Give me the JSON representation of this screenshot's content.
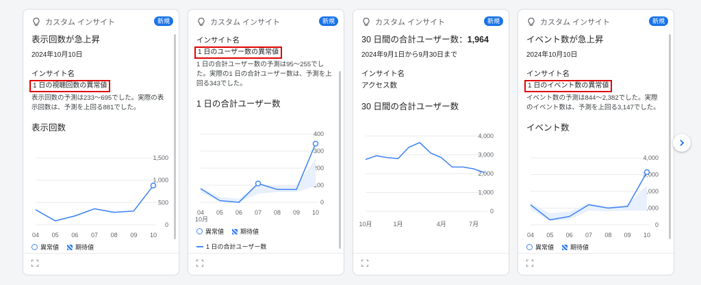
{
  "cards": [
    {
      "header": "カスタム インサイト",
      "badge": "新規",
      "title": "表示回数が急上昇",
      "date": "2024年10月10日",
      "insight_label": "インサイト名",
      "insight_name": "1 日の視聴回数の異常値",
      "description": "表示回数の予測は233～695でした。実際の表示回数は、予測を上回る881でした。",
      "chart_title": "表示回数",
      "legend_anomaly": "異常値",
      "legend_expected": "期待値"
    },
    {
      "header": "カスタム インサイト",
      "badge": "新規",
      "insight_label": "インサイト名",
      "insight_name": "1 日のユーザー数の異常値",
      "description": "1 日の合計ユーザー数の予測は95～255でした。実際の1 日の合計ユーザー数は、予測を上回る343でした。",
      "chart_title": "1 日の合計ユーザー数",
      "legend_anomaly": "異常値",
      "legend_expected": "期待値",
      "legend_series": "1 日の合計ユーザー数"
    },
    {
      "header": "カスタム インサイト",
      "badge": "新規",
      "title_prefix": "30 日間の合計ユーザー数：",
      "title_value": "1,964",
      "date": "2024年9月1日から9月30日まで",
      "insight_label": "インサイト名",
      "insight_name": "アクセス数",
      "chart_title": "30 日間の合計ユーザー数"
    },
    {
      "header": "カスタム インサイト",
      "badge": "新規",
      "title": "イベント数が急上昇",
      "date": "2024年10月10日",
      "insight_label": "インサイト名",
      "insight_name": "1 日のイベント数の異常値",
      "description": "イベント数の予測は844～2,382でした。実際のイベント数は、予測を上回る3,147でした。",
      "chart_title": "イベント数",
      "legend_anomaly": "異常値",
      "legend_expected": "期待値"
    }
  ],
  "chart_data": [
    {
      "type": "line",
      "x": [
        "04",
        "05",
        "06",
        "07",
        "08",
        "09",
        "10"
      ],
      "x_sub": "10月",
      "yticks": [
        "1,500",
        "1,000",
        "500",
        "0"
      ],
      "ylim": [
        0,
        1500
      ],
      "points": [
        [
          0,
          340
        ],
        [
          1,
          90
        ],
        [
          2,
          200
        ],
        [
          3,
          360
        ],
        [
          4,
          280
        ],
        [
          5,
          310
        ],
        [
          6,
          881
        ]
      ],
      "anomaly_index": 6
    },
    {
      "type": "line",
      "x": [
        "04",
        "05",
        "06",
        "07",
        "08",
        "09",
        "10"
      ],
      "x_sub": "10月",
      "yticks": [
        "400",
        "300",
        "200",
        "100",
        "0"
      ],
      "ylim": [
        0,
        400
      ],
      "points": [
        [
          0,
          80
        ],
        [
          1,
          10
        ],
        [
          2,
          0
        ],
        [
          3,
          110
        ],
        [
          4,
          75
        ],
        [
          5,
          75
        ],
        [
          6,
          343
        ]
      ],
      "anomaly_index": 3,
      "anomaly_index_2": 6,
      "band_upper": [
        [
          0,
          90
        ],
        [
          1,
          30
        ],
        [
          2,
          20
        ],
        [
          3,
          100
        ],
        [
          4,
          95
        ],
        [
          5,
          100
        ],
        [
          6,
          255
        ]
      ],
      "band_lower": [
        [
          0,
          60
        ],
        [
          1,
          5
        ],
        [
          2,
          0
        ],
        [
          3,
          50
        ],
        [
          4,
          60
        ],
        [
          5,
          60
        ],
        [
          6,
          95
        ]
      ]
    },
    {
      "type": "line",
      "x_labels": [
        [
          0,
          "10月"
        ],
        [
          3,
          "1月"
        ],
        [
          7,
          "4月"
        ],
        [
          10,
          "7月"
        ]
      ],
      "yticks": [
        "4,000",
        "3,000",
        "2,000",
        "1,000",
        "0"
      ],
      "ylim": [
        0,
        4000
      ],
      "points": [
        [
          0,
          2750
        ],
        [
          1,
          2950
        ],
        [
          2,
          2850
        ],
        [
          3,
          2800
        ],
        [
          4,
          3400
        ],
        [
          5,
          3650
        ],
        [
          6,
          3100
        ],
        [
          7,
          2850
        ],
        [
          8,
          2350
        ],
        [
          9,
          2350
        ],
        [
          10,
          2250
        ],
        [
          11,
          2050
        ]
      ]
    },
    {
      "type": "line",
      "x": [
        "04",
        "05",
        "06",
        "07",
        "08",
        "09",
        "10"
      ],
      "x_sub": "10月",
      "yticks": [
        "4,000",
        "3,000",
        "2,000",
        "1,000",
        "0"
      ],
      "ylim": [
        0,
        4000
      ],
      "points": [
        [
          0,
          1200
        ],
        [
          1,
          300
        ],
        [
          2,
          500
        ],
        [
          3,
          1200
        ],
        [
          4,
          1000
        ],
        [
          5,
          1100
        ],
        [
          6,
          3147
        ]
      ],
      "anomaly_index": 6,
      "band_upper": [
        [
          0,
          1300
        ],
        [
          1,
          700
        ],
        [
          2,
          800
        ],
        [
          3,
          1300
        ],
        [
          4,
          1100
        ],
        [
          5,
          1200
        ],
        [
          6,
          2382
        ]
      ],
      "band_lower": [
        [
          0,
          900
        ],
        [
          1,
          250
        ],
        [
          2,
          300
        ],
        [
          3,
          850
        ],
        [
          4,
          800
        ],
        [
          5,
          850
        ],
        [
          6,
          844
        ]
      ]
    }
  ],
  "nav": {
    "next_icon": "chevron-right-icon"
  }
}
